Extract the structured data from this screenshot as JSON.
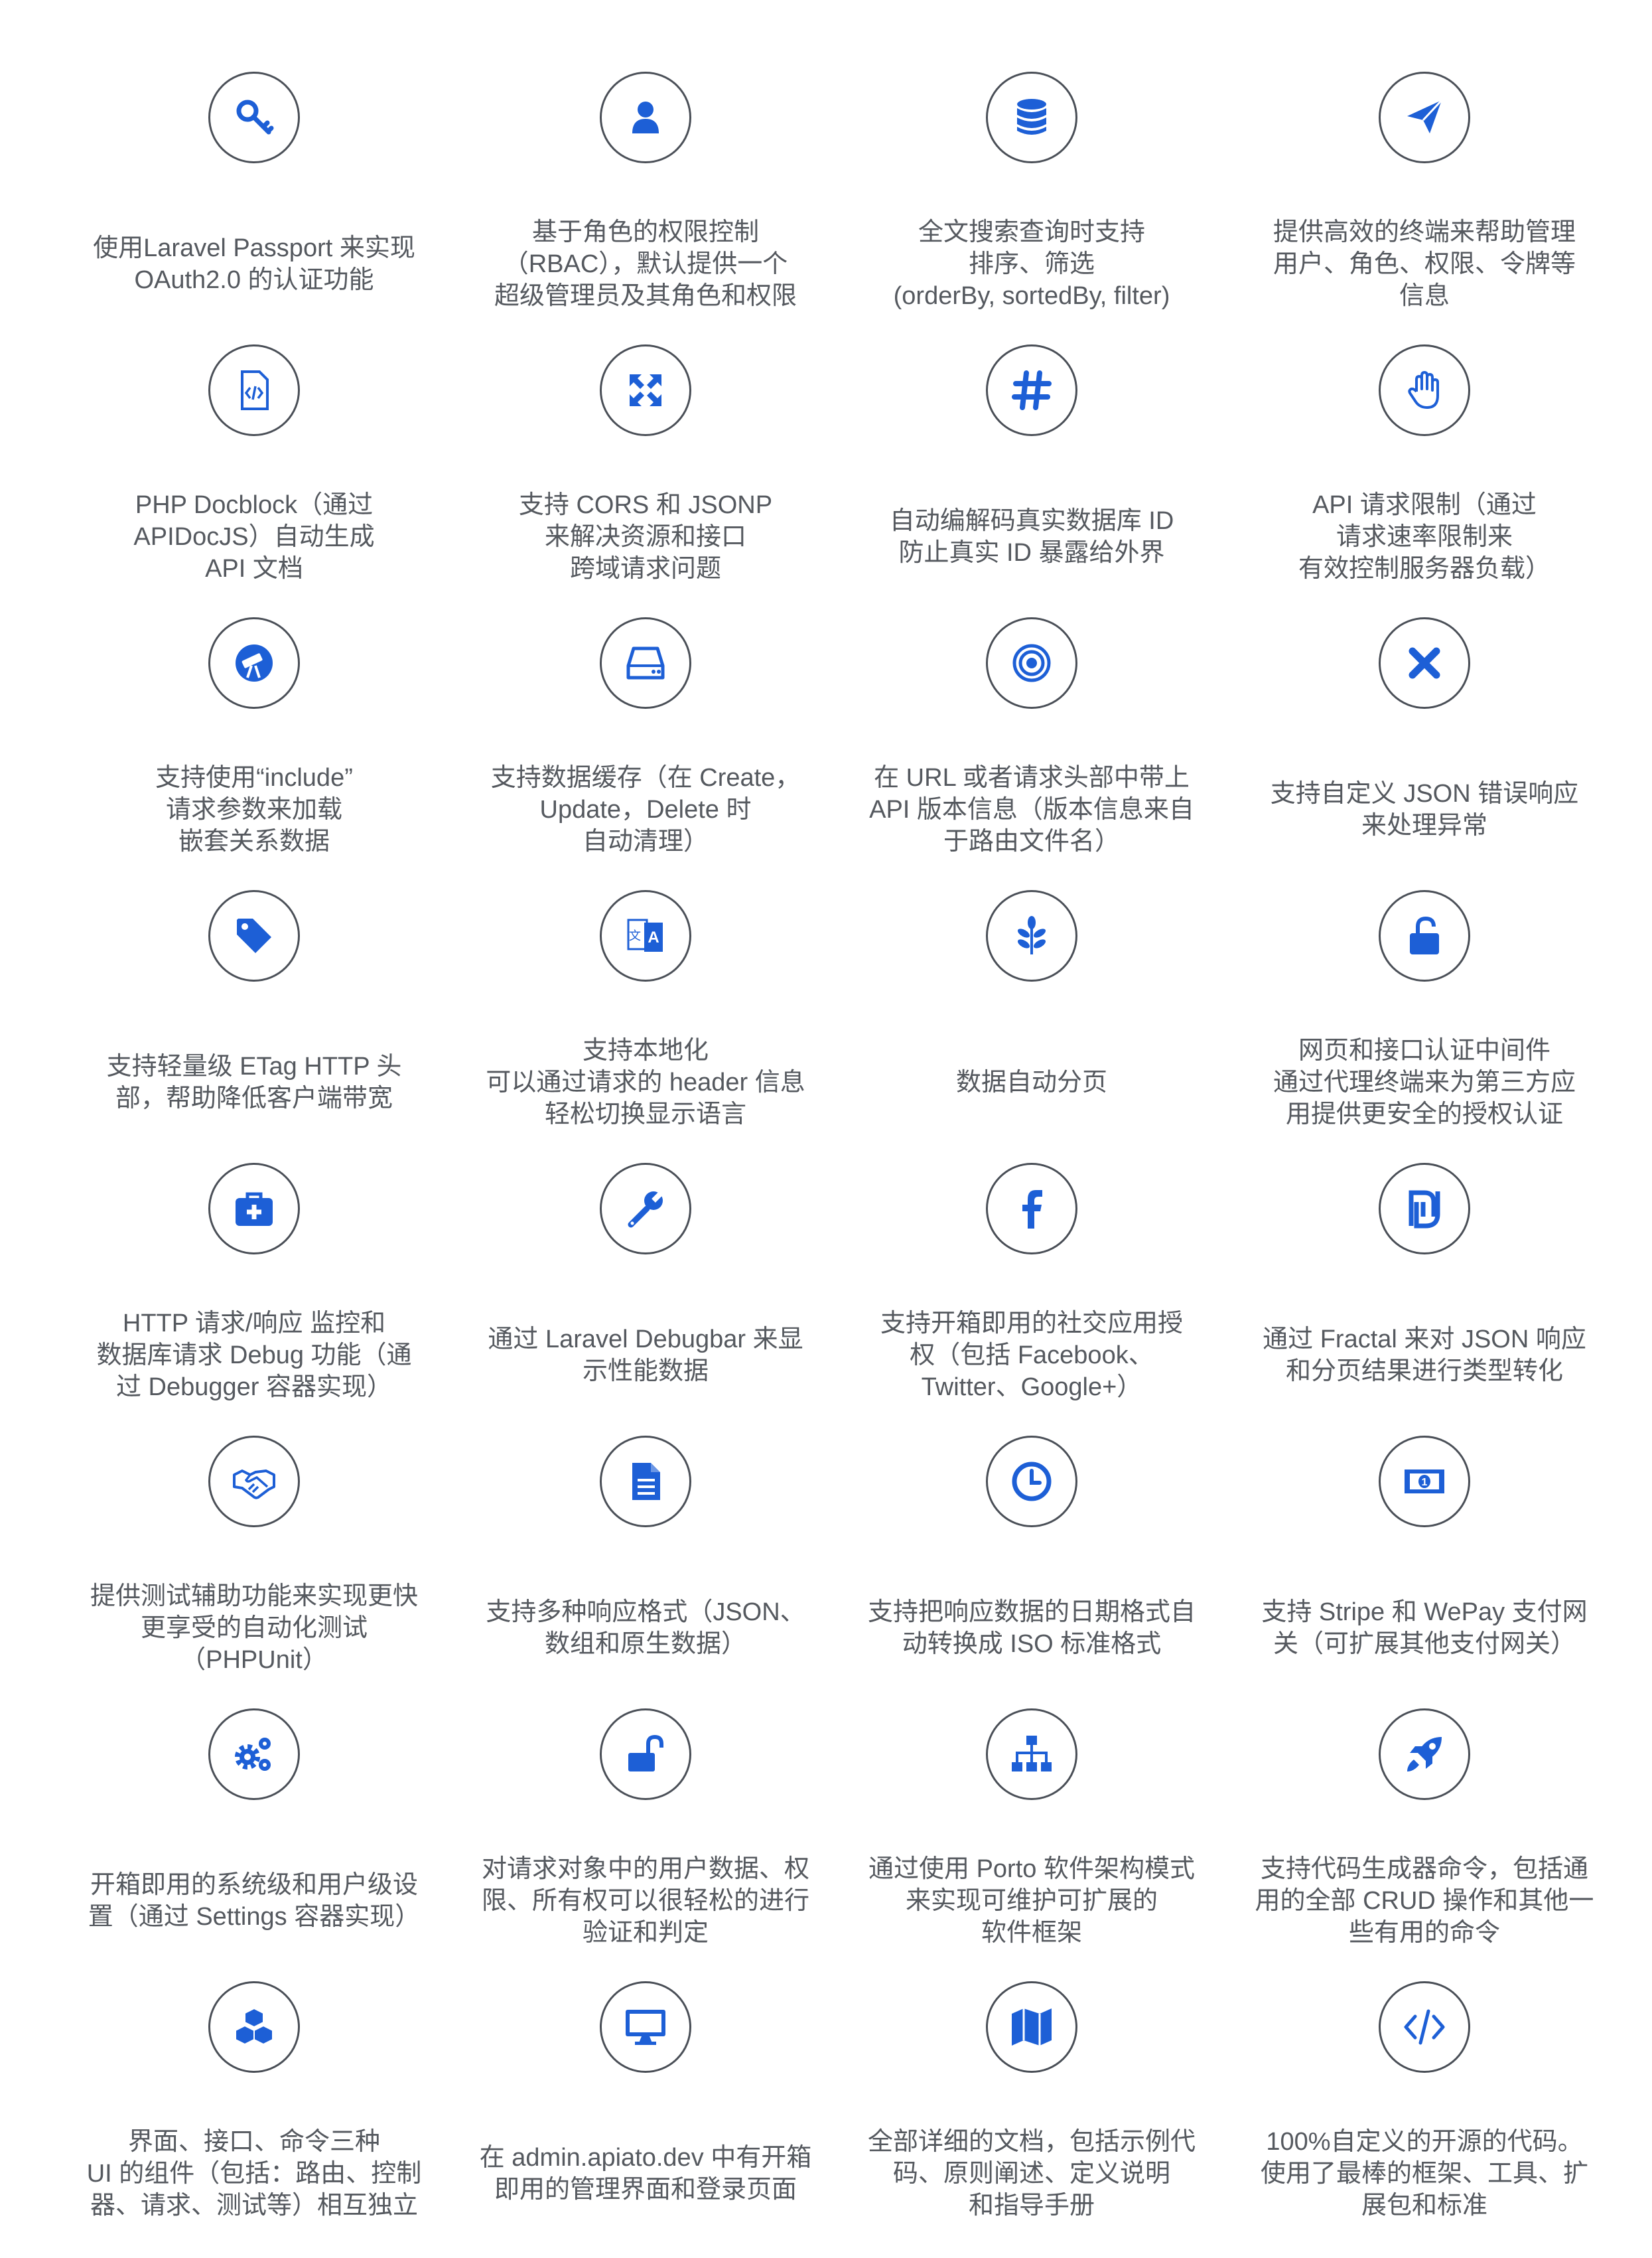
{
  "accent_color": "#1d5fd6",
  "features": [
    {
      "icon": "key-icon",
      "text": "使用Laravel Passport 来实现\nOAuth2.0 的认证功能"
    },
    {
      "icon": "user-icon",
      "text": "基于角色的权限控制\n（RBAC），默认提供一个\n超级管理员及其角色和权限"
    },
    {
      "icon": "database-icon",
      "text": "全文搜索查询时支持\n排序、筛选\n(orderBy, sortedBy, filter)"
    },
    {
      "icon": "paper-plane-icon",
      "text": "提供高效的终端来帮助管理\n用户、角色、权限、令牌等\n信息"
    },
    {
      "icon": "code-file-icon",
      "text": "PHP Docblock（通过\nAPIDocJS）自动生成\nAPI 文档"
    },
    {
      "icon": "expand-arrows-icon",
      "text": "支持 CORS 和 JSONP\n来解决资源和接口\n跨域请求问题"
    },
    {
      "icon": "hashtag-icon",
      "text": "自动编解码真实数据库 ID\n防止真实 ID 暴露给外界"
    },
    {
      "icon": "hand-icon",
      "text": "API 请求限制（通过\n请求速率限制来\n有效控制服务器负载）"
    },
    {
      "icon": "telescope-icon",
      "text": "支持使用“include”\n请求参数来加载\n嵌套关系数据"
    },
    {
      "icon": "hard-drive-icon",
      "text": "支持数据缓存（在 Create，\nUpdate，Delete 时\n自动清理）"
    },
    {
      "icon": "target-icon",
      "text": "在 URL 或者请求头部中带上\nAPI 版本信息（版本信息来自\n于路由文件名）"
    },
    {
      "icon": "close-icon",
      "text": "支持自定义 JSON 错误响应\n来处理异常"
    },
    {
      "icon": "tags-icon",
      "text": "支持轻量级 ETag HTTP 头\n部，帮助降低客户端带宽"
    },
    {
      "icon": "translate-icon",
      "text": "支持本地化\n可以通过请求的 header 信息\n轻松切换显示语言"
    },
    {
      "icon": "leaf-icon",
      "text": "数据自动分页"
    },
    {
      "icon": "unlock-icon",
      "text": "网页和接口认证中间件\n通过代理终端来为第三方应\n用提供更安全的授权认证"
    },
    {
      "icon": "medkit-icon",
      "text": "HTTP 请求/响应 监控和\n数据库请求 Debug 功能（通\n过 Debugger 容器实现）"
    },
    {
      "icon": "wrench-icon",
      "text": "通过 Laravel Debugbar 来显\n示性能数据"
    },
    {
      "icon": "facebook-icon",
      "text": "支持开箱即用的社交应用授\n权（包括 Facebook、\nTwitter、Google+）"
    },
    {
      "icon": "shekel-icon",
      "text": "通过 Fractal 来对 JSON 响应\n和分页结果进行类型转化"
    },
    {
      "icon": "handshake-icon",
      "text": "提供测试辅助功能来实现更快\n更享受的自动化测试\n（PHPUnit）"
    },
    {
      "icon": "document-icon",
      "text": "支持多种响应格式（JSON、\n数组和原生数据）"
    },
    {
      "icon": "clock-icon",
      "text": "支持把响应数据的日期格式自\n动转换成 ISO 标准格式"
    },
    {
      "icon": "money-icon",
      "text": "支持 Stripe 和 WePay 支付网\n关（可扩展其他支付网关）"
    },
    {
      "icon": "gears-icon",
      "text": "开箱即用的系统级和用户级设\n置（通过 Settings 容器实现）"
    },
    {
      "icon": "open-lock-icon",
      "text": "对请求对象中的用户数据、权\n限、所有权可以很轻松的进行\n验证和判定"
    },
    {
      "icon": "sitemap-icon",
      "text": "通过使用 Porto 软件架构模式\n来实现可维护可扩展的\n软件框架"
    },
    {
      "icon": "rocket-icon",
      "text": "支持代码生成器命令，包括通\n用的全部 CRUD 操作和其他一\n些有用的命令"
    },
    {
      "icon": "cubes-icon",
      "text": "界面、接口、命令三种\nUI 的组件（包括：路由、控制\n器、请求、测试等）相互独立"
    },
    {
      "icon": "desktop-icon",
      "text": "在 admin.apiato.dev 中有开箱\n即用的管理界面和登录页面"
    },
    {
      "icon": "map-icon",
      "text": "全部详细的文档，包括示例代\n码、原则阐述、定义说明\n和指导手册"
    },
    {
      "icon": "code-icon",
      "text": "100%自定义的开源的代码。\n使用了最棒的框架、工具、扩\n展包和标准"
    }
  ]
}
